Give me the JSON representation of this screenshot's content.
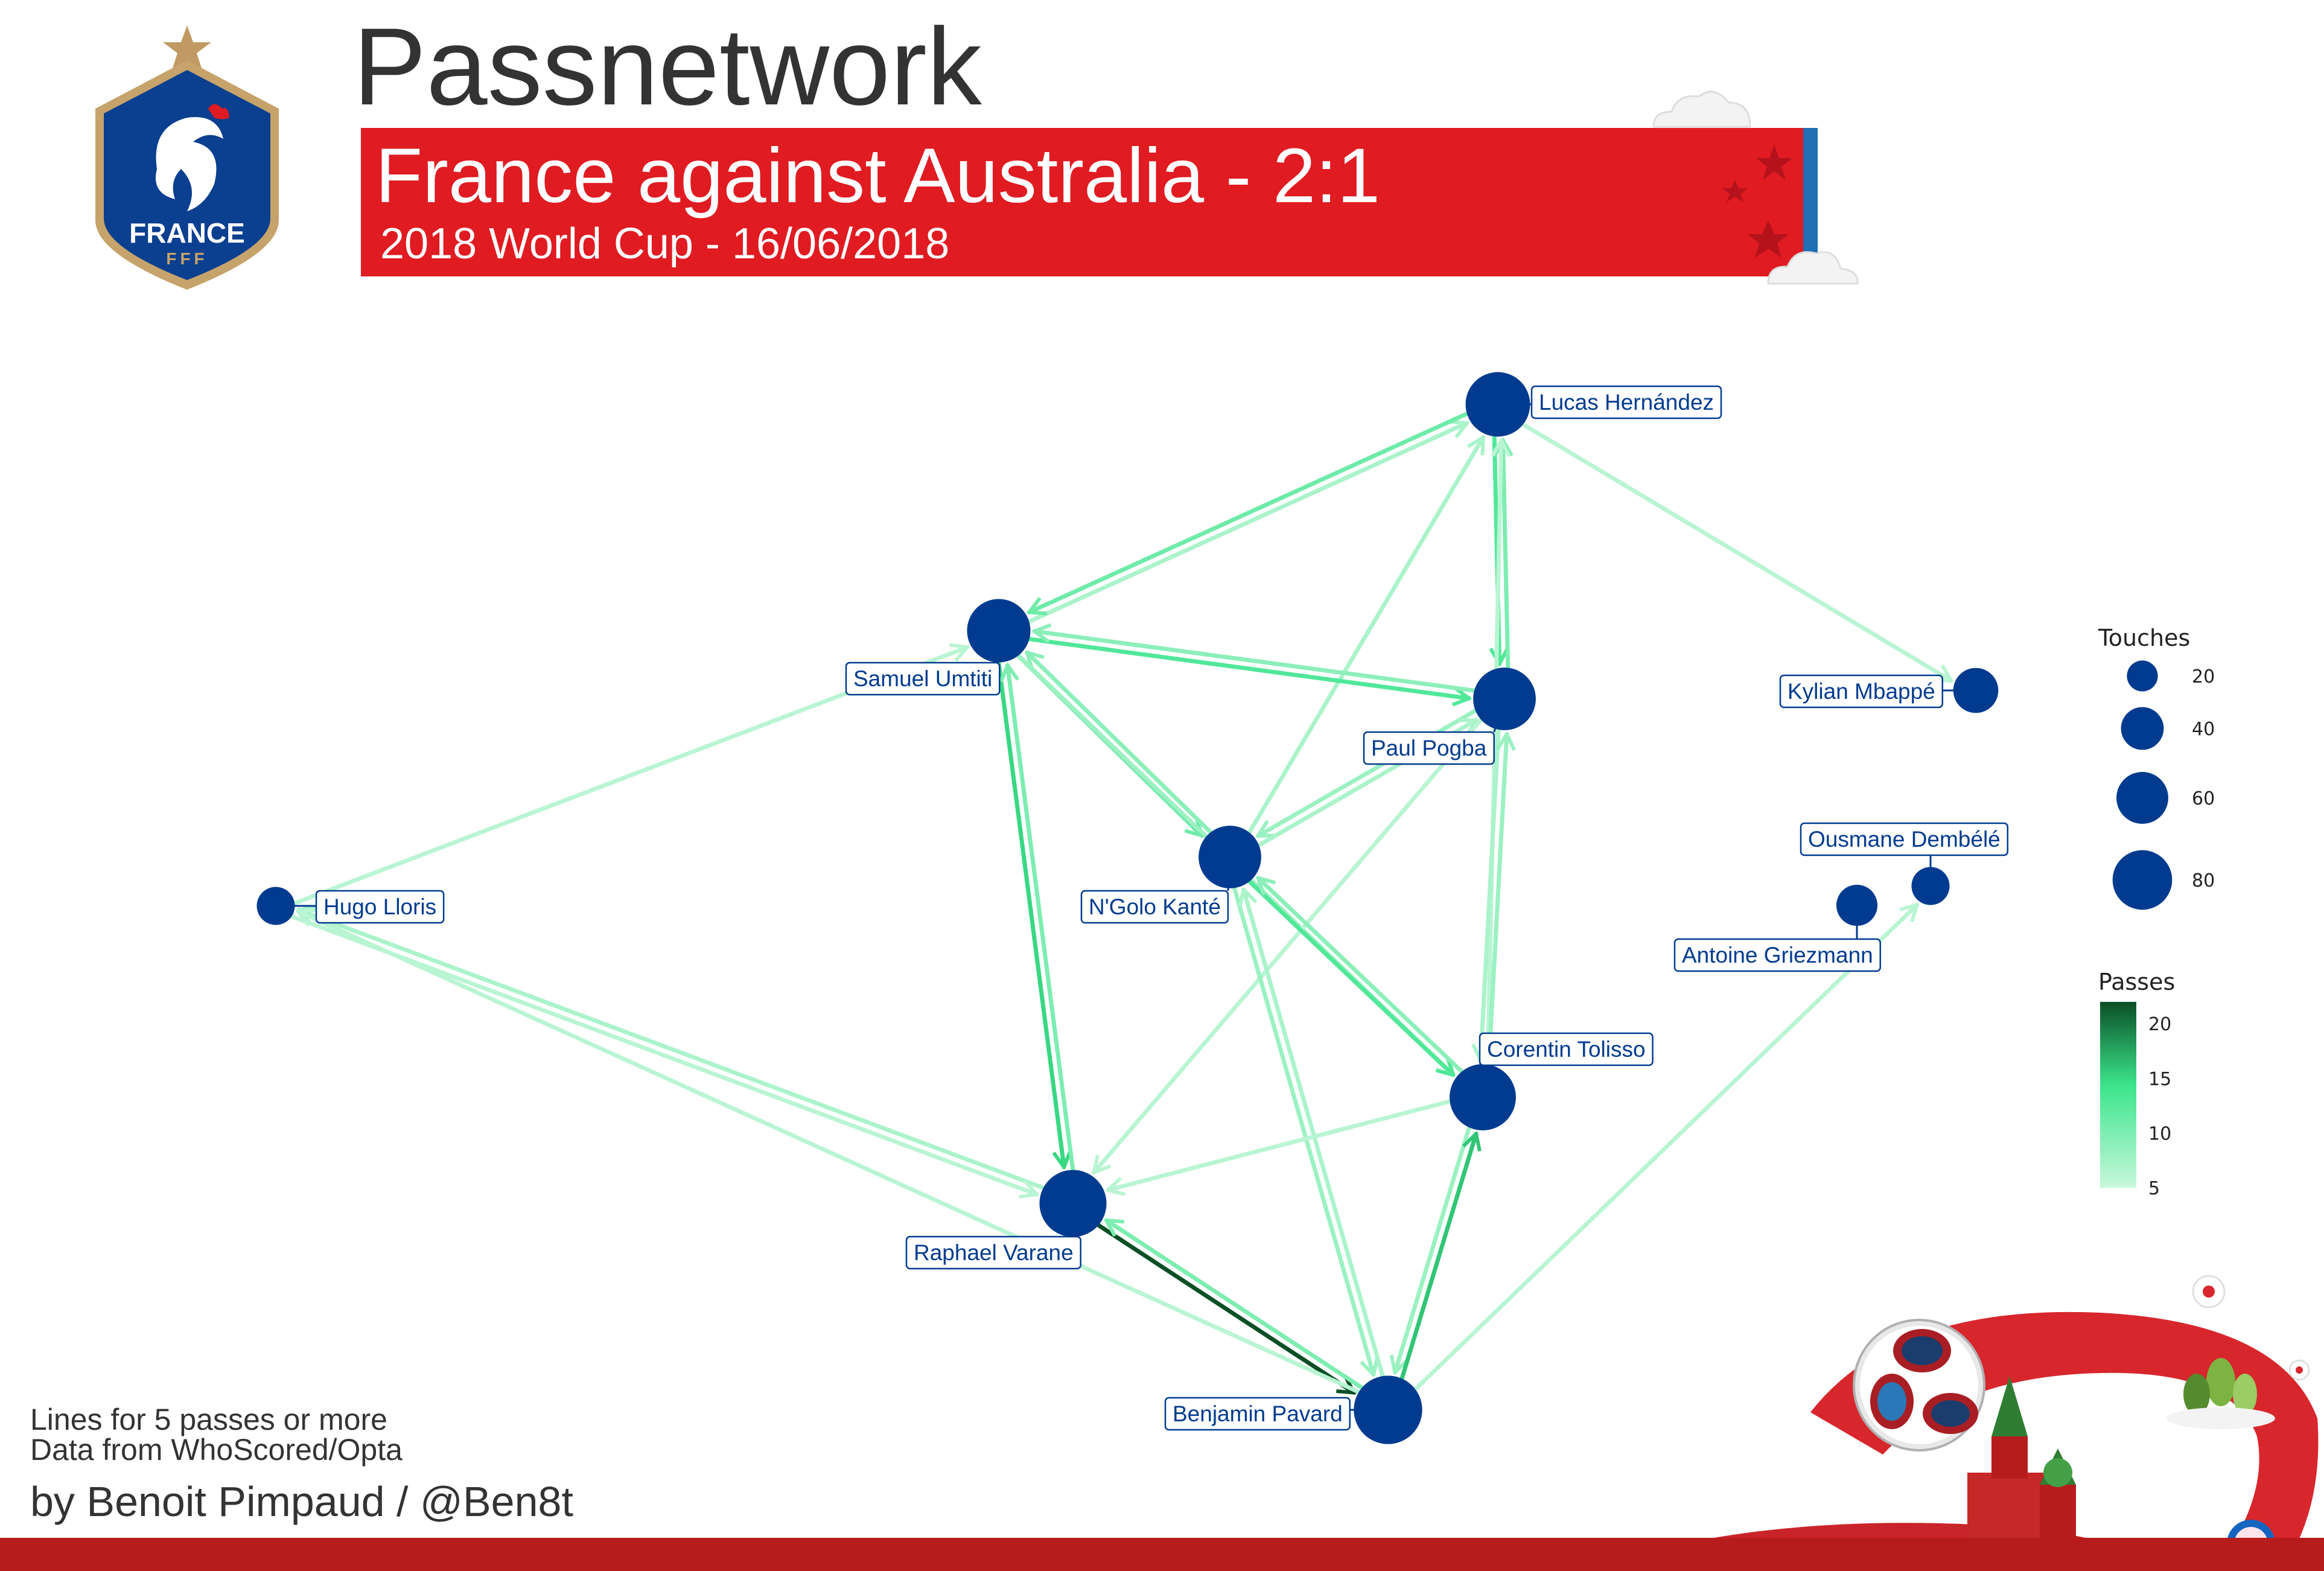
{
  "header": {
    "title": "Passnetwork",
    "match_title": "France against Australia - 2:1",
    "match_subtitle": "2018 World Cup - 16/06/2018",
    "crest_text": "FRANCE",
    "crest_subtext": "FFF"
  },
  "colors": {
    "node": "#003b8f",
    "banner_red": "#e01b22",
    "banner_blue": "#1f6fb5",
    "edge_low": "#c8f7dc",
    "edge_high": "#0a4f25"
  },
  "players": [
    {
      "id": "hernandez",
      "label": "Lucas Hernández",
      "touches": 85
    },
    {
      "id": "umtiti",
      "label": "Samuel Umtiti",
      "touches": 82
    },
    {
      "id": "pogba",
      "label": "Paul Pogba",
      "touches": 80
    },
    {
      "id": "mbappe",
      "label": "Kylian Mbappé",
      "touches": 40
    },
    {
      "id": "kante",
      "label": "N'Golo Kanté",
      "touches": 80
    },
    {
      "id": "lloris",
      "label": "Hugo Lloris",
      "touches": 28
    },
    {
      "id": "dembele",
      "label": "Ousmane Dembélé",
      "touches": 28
    },
    {
      "id": "griezmann",
      "label": "Antoine Griezmann",
      "touches": 33
    },
    {
      "id": "tolisso",
      "label": "Corentin Tolisso",
      "touches": 90
    },
    {
      "id": "varane",
      "label": "Raphael Varane",
      "touches": 92
    },
    {
      "id": "pavard",
      "label": "Benjamin Pavard",
      "touches": 96
    }
  ],
  "passes": [
    {
      "from": "umtiti",
      "to": "hernandez",
      "count": 7
    },
    {
      "from": "hernandez",
      "to": "umtiti",
      "count": 11
    },
    {
      "from": "hernandez",
      "to": "pogba",
      "count": 13
    },
    {
      "from": "pogba",
      "to": "hernandez",
      "count": 10
    },
    {
      "from": "hernandez",
      "to": "mbappe",
      "count": 6
    },
    {
      "from": "kante",
      "to": "hernandez",
      "count": 7
    },
    {
      "from": "tolisso",
      "to": "hernandez",
      "count": 6
    },
    {
      "from": "umtiti",
      "to": "pogba",
      "count": 13
    },
    {
      "from": "pogba",
      "to": "umtiti",
      "count": 9
    },
    {
      "from": "umtiti",
      "to": "kante",
      "count": 11
    },
    {
      "from": "kante",
      "to": "umtiti",
      "count": 9
    },
    {
      "from": "umtiti",
      "to": "varane",
      "count": 15
    },
    {
      "from": "varane",
      "to": "umtiti",
      "count": 10
    },
    {
      "from": "umtiti",
      "to": "tolisso",
      "count": 8
    },
    {
      "from": "lloris",
      "to": "umtiti",
      "count": 6
    },
    {
      "from": "pogba",
      "to": "kante",
      "count": 8
    },
    {
      "from": "kante",
      "to": "pogba",
      "count": 7
    },
    {
      "from": "pogba",
      "to": "tolisso",
      "count": 7
    },
    {
      "from": "tolisso",
      "to": "pogba",
      "count": 8
    },
    {
      "from": "pogba",
      "to": "varane",
      "count": 6
    },
    {
      "from": "kante",
      "to": "tolisso",
      "count": 13
    },
    {
      "from": "tolisso",
      "to": "kante",
      "count": 9
    },
    {
      "from": "kante",
      "to": "pavard",
      "count": 8
    },
    {
      "from": "pavard",
      "to": "kante",
      "count": 7
    },
    {
      "from": "tolisso",
      "to": "varane",
      "count": 6
    },
    {
      "from": "tolisso",
      "to": "pavard",
      "count": 8
    },
    {
      "from": "pavard",
      "to": "tolisso",
      "count": 16
    },
    {
      "from": "varane",
      "to": "pavard",
      "count": 22
    },
    {
      "from": "pavard",
      "to": "varane",
      "count": 10
    },
    {
      "from": "varane",
      "to": "lloris",
      "count": 7
    },
    {
      "from": "lloris",
      "to": "varane",
      "count": 6
    },
    {
      "from": "pavard",
      "to": "lloris",
      "count": 6
    },
    {
      "from": "pavard",
      "to": "dembele",
      "count": 6
    }
  ],
  "legend": {
    "touches_title": "Touches",
    "touches_sizes": [
      20,
      40,
      60,
      80
    ],
    "touches_labels": [
      "20",
      "40",
      "60",
      "80"
    ],
    "passes_title": "Passes",
    "passes_ticks": [
      5,
      10,
      15,
      20
    ],
    "passes_labels": [
      "5",
      "10",
      "15",
      "20"
    ],
    "passes_range": [
      5,
      22
    ]
  },
  "footer": {
    "note_1": "Lines for 5 passes or more",
    "note_2": "Data from WhoScored/Opta",
    "author": "by Benoit Pimpaud / @Ben8t"
  }
}
